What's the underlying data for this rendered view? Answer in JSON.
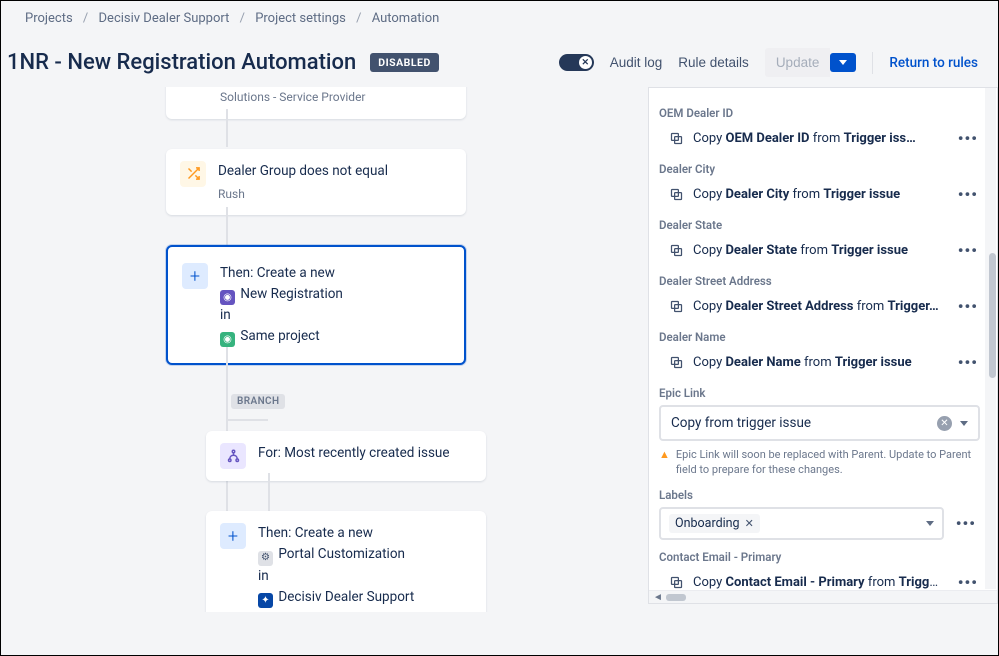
{
  "breadcrumb": {
    "items": [
      "Projects",
      "Decisiv Dealer Support",
      "Project settings",
      "Automation"
    ]
  },
  "header": {
    "title": "1NR - New Registration Automation",
    "status_badge": "DISABLED",
    "toggle_state": "off",
    "audit_log": "Audit log",
    "rule_details": "Rule details",
    "update": "Update",
    "return": "Return to rules"
  },
  "flow": {
    "card0_sub": "Solutions - Service Provider",
    "card1": {
      "title": "Dealer Group does not equal",
      "sub": "Rush"
    },
    "card2": {
      "line1": "Then: Create a new",
      "type": "New Registration",
      "line2": "in",
      "project": "Same project"
    },
    "branch_tag": "BRANCH",
    "card3": {
      "text": "For: Most recently created issue"
    },
    "card4": {
      "line1": "Then: Create a new",
      "type": "Portal Customization",
      "line2": "in",
      "project": "Decisiv Dealer Support"
    }
  },
  "panel": {
    "fields": [
      {
        "label": "OEM Dealer ID",
        "copy_pre": "Copy ",
        "copy_field": "OEM Dealer ID",
        "copy_mid": " from ",
        "copy_src": "Trigger iss…"
      },
      {
        "label": "Dealer City",
        "copy_pre": "Copy ",
        "copy_field": "Dealer City",
        "copy_mid": " from ",
        "copy_src": "Trigger issue"
      },
      {
        "label": "Dealer State",
        "copy_pre": "Copy ",
        "copy_field": "Dealer State",
        "copy_mid": " from ",
        "copy_src": "Trigger issue"
      },
      {
        "label": "Dealer Street Address",
        "copy_pre": "Copy ",
        "copy_field": "Dealer Street Address",
        "copy_mid": " from ",
        "copy_src": "Trigger…"
      },
      {
        "label": "Dealer Name",
        "copy_pre": "Copy ",
        "copy_field": "Dealer Name",
        "copy_mid": " from ",
        "copy_src": "Trigger issue"
      }
    ],
    "epic_link": {
      "label": "Epic Link",
      "value": "Copy from trigger issue",
      "warning": "Epic Link will soon be replaced with Parent. Update to Parent field to prepare for these changes."
    },
    "labels": {
      "label": "Labels",
      "chips": [
        "Onboarding"
      ]
    },
    "contact_email": {
      "label": "Contact Email - Primary",
      "copy_pre": "Copy ",
      "copy_field": "Contact Email - Primary",
      "copy_mid": " from ",
      "copy_src": "Trigge…"
    }
  }
}
